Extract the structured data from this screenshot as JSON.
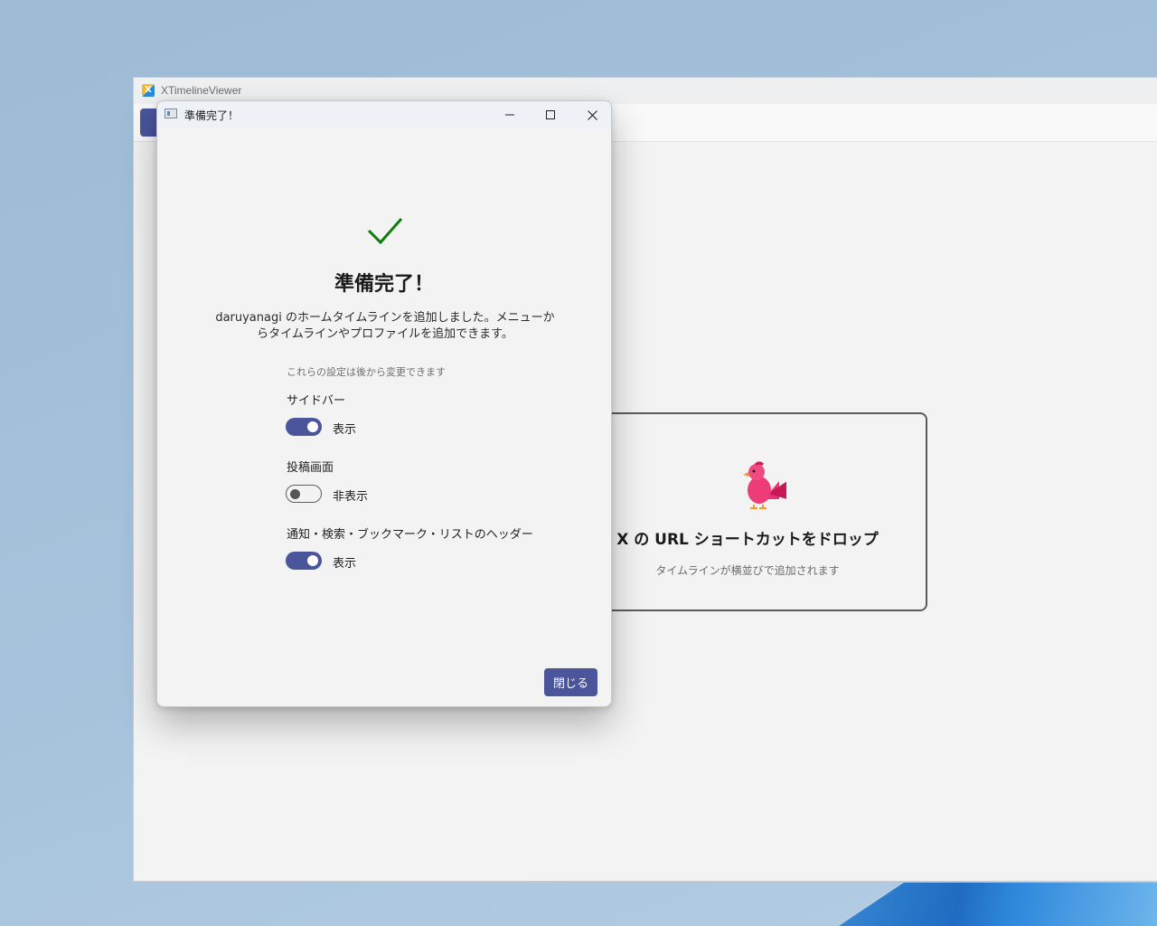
{
  "main_window": {
    "title": "XTimelineViewer",
    "app_icon_letter": "X",
    "drop_zone": {
      "title": "X の URL ショートカットをドロップ",
      "subtitle": "タイムラインが横並びで追加されます",
      "icon": "bird-icon"
    }
  },
  "dialog": {
    "window_title": "準備完了！",
    "heading": "準備完了！",
    "message": "daruyanagi のホームタイムラインを追加しました。メニューからタイムラインやプロファイルを追加できます。",
    "settings_note": "これらの設定は後から変更できます",
    "settings": [
      {
        "label": "サイドバー",
        "state": "表示",
        "on": true
      },
      {
        "label": "投稿画面",
        "state": "非表示",
        "on": false
      },
      {
        "label": "通知・検索・ブックマーク・リストのヘッダー",
        "state": "表示",
        "on": true
      }
    ],
    "close_button": "閉じる",
    "icons": {
      "success": "check-icon"
    }
  },
  "colors": {
    "accent": "#4a559b",
    "success": "#107c10",
    "bird": "#e8336f"
  }
}
